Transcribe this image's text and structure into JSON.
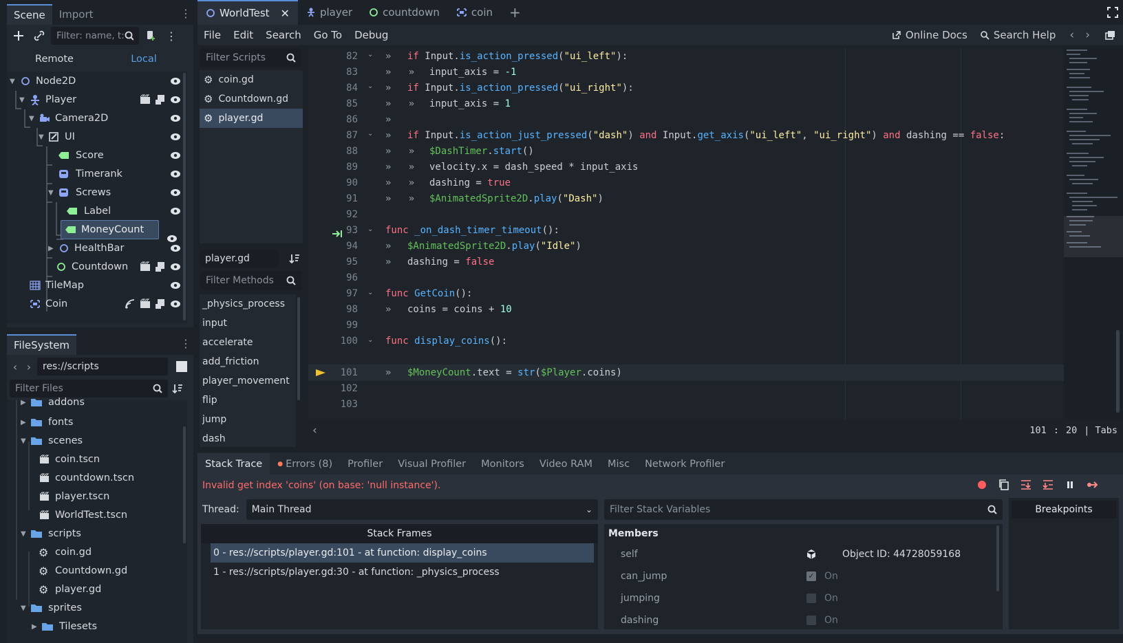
{
  "left_dock": {
    "tabs": [
      "Scene",
      "Import"
    ],
    "scene_filter_placeholder": "Filter: name, t:t",
    "remote_label": "Remote",
    "local_label": "Local",
    "tree": [
      {
        "label": "Node2D"
      },
      {
        "label": "Player"
      },
      {
        "label": "Camera2D"
      },
      {
        "label": "UI"
      },
      {
        "label": "Score"
      },
      {
        "label": "Timerank"
      },
      {
        "label": "Screws"
      },
      {
        "label": "Label"
      },
      {
        "label": "MoneyCount"
      },
      {
        "label": "HealthBar"
      },
      {
        "label": "Countdown"
      },
      {
        "label": "TileMap"
      },
      {
        "label": "Coin"
      }
    ],
    "filesystem_tab": "FileSystem",
    "path": "res://scripts",
    "filter_files_placeholder": "Filter Files",
    "files": [
      {
        "label": "addons"
      },
      {
        "label": "fonts"
      },
      {
        "label": "scenes"
      },
      {
        "label": "coin.tscn"
      },
      {
        "label": "countdown.tscn"
      },
      {
        "label": "player.tscn"
      },
      {
        "label": "WorldTest.tscn"
      },
      {
        "label": "scripts"
      },
      {
        "label": "coin.gd"
      },
      {
        "label": "Countdown.gd"
      },
      {
        "label": "player.gd"
      },
      {
        "label": "sprites"
      },
      {
        "label": "Tilesets"
      }
    ]
  },
  "scene_tabs": [
    {
      "label": "WorldTest"
    },
    {
      "label": "player"
    },
    {
      "label": "countdown"
    },
    {
      "label": "coin"
    }
  ],
  "menus": [
    "File",
    "Edit",
    "Search",
    "Go To",
    "Debug"
  ],
  "menu_right": {
    "online_docs": "Online Docs",
    "search_help": "Search Help"
  },
  "scripts_panel": {
    "filter_placeholder": "Filter Scripts",
    "scripts": [
      "coin.gd",
      "Countdown.gd",
      "player.gd"
    ],
    "current_script": "player.gd",
    "filter_methods_placeholder": "Filter Methods",
    "methods": [
      "_physics_process",
      "input",
      "accelerate",
      "add_friction",
      "player_movement",
      "flip",
      "jump",
      "dash"
    ]
  },
  "code": {
    "line_numbers": [
      "82",
      "83",
      "84",
      "85",
      "86",
      "87",
      "88",
      "89",
      "90",
      "91",
      "92",
      "93",
      "94",
      "95",
      "96",
      "97",
      "98",
      "99",
      "100",
      "101",
      "102",
      "103"
    ],
    "l82a": "if",
    "l82b": " Input.",
    "l82c": "is_action_pressed",
    "l82d": "(",
    "l82e": "\"ui_left\"",
    "l82f": "):",
    "l83a": "input_axis = ",
    "l83b": "-1",
    "l84a": "if",
    "l84b": " Input.",
    "l84c": "is_action_pressed",
    "l84d": "(",
    "l84e": "\"ui_right\"",
    "l84f": "):",
    "l85a": "input_axis = ",
    "l85b": "1",
    "l87a": "if",
    "l87b": " Input.",
    "l87c": "is_action_just_pressed",
    "l87d": "(",
    "l87e": "\"dash\"",
    "l87f": ") ",
    "l87g": "and",
    "l87h": " Input.",
    "l87i": "get_axis",
    "l87j": "(",
    "l87k": "\"ui_left\"",
    "l87l": ", ",
    "l87m": "\"ui_right\"",
    "l87n": ") ",
    "l87o": "and",
    "l87p": " dashing == ",
    "l87q": "false",
    "l87r": ":",
    "l88a": "$DashTimer",
    "l88b": ".",
    "l88c": "start",
    "l88d": "()",
    "l89a": "velocity.x = dash_speed * input_axis",
    "l90a": "dashing = ",
    "l90b": "true",
    "l91a": "$AnimatedSprite2D",
    "l91b": ".",
    "l91c": "play",
    "l91d": "(",
    "l91e": "\"Dash\"",
    "l91f": ")",
    "l93a": "func",
    "l93b": " ",
    "l93c": "_on_dash_timer_timeout",
    "l93d": "():",
    "l94a": "$AnimatedSprite2D",
    "l94b": ".",
    "l94c": "play",
    "l94d": "(",
    "l94e": "\"Idle\"",
    "l94f": ")",
    "l95a": "dashing = ",
    "l95b": "false",
    "l97a": "func",
    "l97b": " ",
    "l97c": "GetCoin",
    "l97d": "():",
    "l98a": "coins = coins + ",
    "l98b": "10",
    "l100a": "func",
    "l100b": " ",
    "l100c": "display_coins",
    "l100d": "():",
    "l101a": "$MoneyCount",
    "l101b": ".text = ",
    "l101c": "str",
    "l101d": "(",
    "l101e": "$Player",
    "l101f": ".coins)"
  },
  "status_bar": {
    "line": "101",
    "sep": ":",
    "col": "20",
    "indent": "| Tabs"
  },
  "bottom_tabs": [
    "Stack Trace",
    "Errors (8)",
    "Profiler",
    "Visual Profiler",
    "Monitors",
    "Video RAM",
    "Misc",
    "Network Profiler"
  ],
  "debugger": {
    "error_message": "Invalid get index 'coins' (on base: 'null instance').",
    "thread_label": "Thread:",
    "thread_value": "Main Thread",
    "stack_frames_header": "Stack Frames",
    "frames": [
      "0 - res://scripts/player.gd:101 - at function: display_coins",
      "1 - res://scripts/player.gd:30 - at function: _physics_process"
    ],
    "filter_vars_placeholder": "Filter Stack Variables",
    "members_header": "Members",
    "vars": [
      {
        "name": "self",
        "value": "Object ID: 44728059168"
      },
      {
        "name": "can_jump",
        "value": "On"
      },
      {
        "name": "jumping",
        "value": "On"
      },
      {
        "name": "dashing",
        "value": "On"
      }
    ],
    "breakpoints_label": "Breakpoints"
  },
  "colors": {
    "accent": "#5a8fd8",
    "error": "#ff6b6b",
    "selection": "#3a4a5e"
  }
}
